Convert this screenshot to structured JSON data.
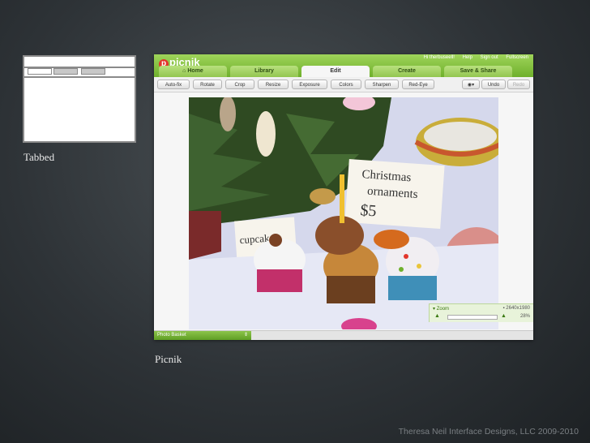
{
  "slide": {
    "left_caption": "Tabbed",
    "right_caption": "Picnik",
    "footer": "Theresa Neil Interface Designs, LLC 2009-2010"
  },
  "app": {
    "logo": "picnik",
    "top_links": [
      "Hi therbuseell!",
      "Help",
      "Sign out",
      "Fullscreen"
    ],
    "tabs": [
      {
        "label": "Home"
      },
      {
        "label": "Library"
      },
      {
        "label": "Edit",
        "active": true
      },
      {
        "label": "Create"
      },
      {
        "label": "Save & Share"
      }
    ],
    "tools": [
      "Auto-fix",
      "Rotate",
      "Crop",
      "Resize",
      "Exposure",
      "Colors",
      "Sharpen",
      "Red-Eye"
    ],
    "undo": "Undo",
    "redo": "Redo",
    "photo": {
      "sign_text_1": "Christmas",
      "sign_text_2": "ornaments",
      "sign_price": "$5",
      "cupcake_sign": "cupcakes"
    },
    "photo_basket": "Photo Basket",
    "zoom": {
      "label": "Zoom",
      "dimensions": "2640x1980",
      "percent": "28%"
    }
  },
  "colors": {
    "header_green": "#7fbf3a",
    "accent_red": "#e2352b"
  }
}
